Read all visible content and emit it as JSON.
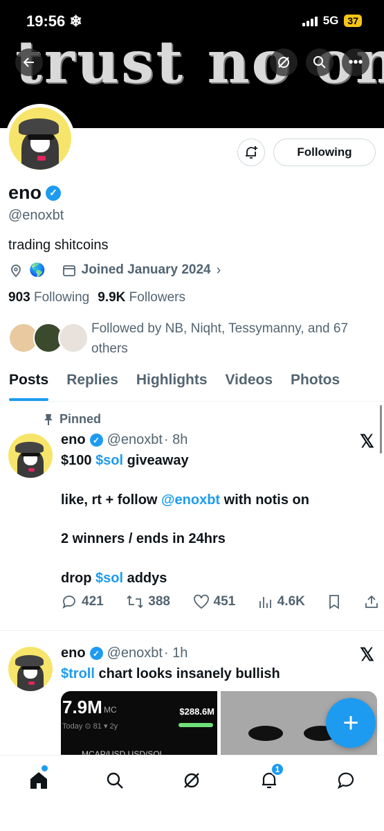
{
  "status_bar": {
    "time": "19:56",
    "time_icon": "snowflake-icon",
    "network": "5G",
    "battery": "37"
  },
  "banner": {
    "text": "trust no one"
  },
  "profile": {
    "name": "eno",
    "handle": "@enoxbt",
    "bio": "trading shitcoins",
    "joined": "Joined January 2024",
    "following_count": "903",
    "following_label": "Following",
    "followers_count": "9.9K",
    "followers_label": "Followers",
    "followed_by": "Followed by NB, Niqht, Tessymanny, and 67 others",
    "follow_button": "Following"
  },
  "tabs": [
    {
      "label": "Posts",
      "active": true
    },
    {
      "label": "Replies"
    },
    {
      "label": "Highlights"
    },
    {
      "label": "Videos"
    },
    {
      "label": "Photos"
    }
  ],
  "posts": [
    {
      "pinned_label": "Pinned",
      "name": "eno",
      "handle": "@enoxbt",
      "time": "· 8h",
      "lines": {
        "l1_pre": "$100 ",
        "l1_link": "$sol",
        "l1_post": " giveaway",
        "l2_pre": "like, rt + follow ",
        "l2_link": "@enoxbt",
        "l2_post": " with notis on",
        "l3": "2 winners / ends in 24hrs",
        "l4_pre": "drop ",
        "l4_link": "$sol",
        "l4_post": " addys"
      },
      "stats": {
        "replies": "421",
        "reposts": "388",
        "likes": "451",
        "views": "4.6K"
      }
    },
    {
      "name": "eno",
      "handle": "@enoxbt",
      "time": "· 1h",
      "text_link": "$troll",
      "text_post": " chart looks insanely bullish",
      "media": {
        "market_cap": "7.9M",
        "mc_label": "MC",
        "price": "$288.6M",
        "sub": "Today  ⊙ 81  ▾ 2y",
        "pairs": "MCAP/USD   USD/SOL"
      }
    }
  ],
  "nav": {
    "notifications_badge": "1"
  },
  "colors": {
    "accent": "#1d9bf0",
    "text": "#0f1419",
    "muted": "#536471"
  }
}
